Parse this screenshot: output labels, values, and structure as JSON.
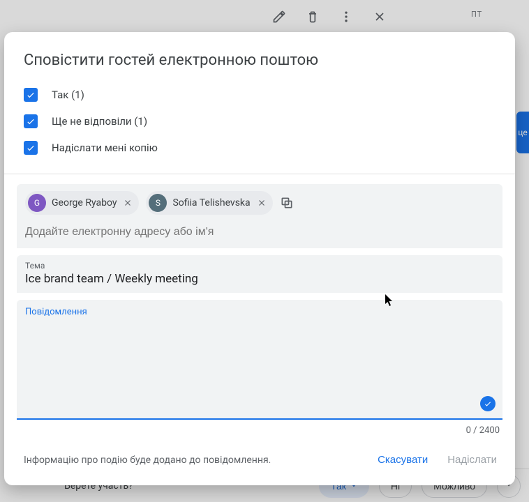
{
  "background": {
    "day_label": "ПТ",
    "right_edge_text": "це"
  },
  "rsvp": {
    "question": "Берете участь?",
    "yes": "Так",
    "no": "Ні",
    "maybe": "Можливо"
  },
  "modal": {
    "title": "Сповістити гостей електронною поштою",
    "checks": [
      {
        "label": "Так (1)"
      },
      {
        "label": "Ще не відповіли (1)"
      },
      {
        "label": "Надіслати мені копію"
      }
    ],
    "recipients": [
      {
        "name": "George Ryaboy",
        "initial": "G",
        "avatar_color": "#7e57c2"
      },
      {
        "name": "Sofiia Telishevska",
        "initial": "S",
        "avatar_color": "#546e7a"
      }
    ],
    "recipient_placeholder": "Додайте електронну адресу або ім'я",
    "subject_label": "Тема",
    "subject_value": "Ice brand team / Weekly meeting",
    "message_label": "Повідомлення",
    "message_value": "",
    "char_counter": "0 / 2400",
    "footer_note": "Інформацію про подію буде додано до повідомлення.",
    "cancel": "Скасувати",
    "send": "Надіслати"
  }
}
